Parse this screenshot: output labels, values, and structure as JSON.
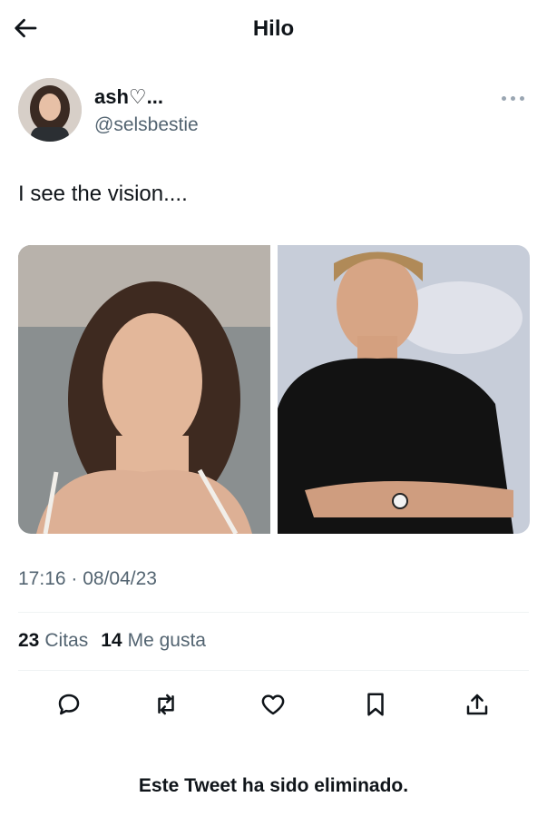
{
  "header": {
    "title": "Hilo",
    "back_icon": "arrow-left-icon"
  },
  "tweet": {
    "author": {
      "display_name": "ash♡...",
      "handle": "@selsbestie"
    },
    "text": "I see the vision....",
    "timestamp": "17:16 · 08/04/23",
    "stats": [
      {
        "value": "23",
        "label": "Citas"
      },
      {
        "value": "14",
        "label": "Me gusta"
      }
    ],
    "actions": [
      "reply-icon",
      "retweet-icon",
      "like-icon",
      "bookmark-icon",
      "share-icon"
    ]
  },
  "footer": {
    "deleted_notice": "Este Tweet ha sido eliminado."
  },
  "colors": {
    "text": "#0f1419",
    "secondary": "#536471",
    "divider": "#eff3f4"
  }
}
